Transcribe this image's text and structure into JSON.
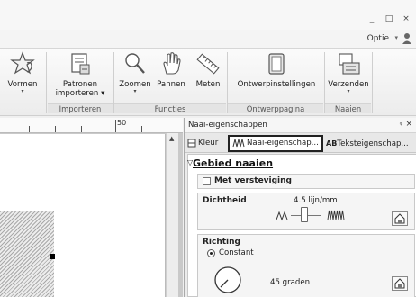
{
  "window": {
    "controls": [
      "_",
      "□",
      "×"
    ]
  },
  "topbar": {
    "options_label": "Optie",
    "options_arrow": "▾"
  },
  "ribbon": {
    "buttons": [
      {
        "id": "vormen",
        "label": "Vormen",
        "caret": "▾",
        "icon": "star-shapes-icon"
      },
      {
        "id": "patronen",
        "label": "Patronen importeren ▾",
        "icon": "import-pattern-icon"
      },
      {
        "id": "zoomen",
        "label": "Zoomen",
        "caret": "▾",
        "icon": "magnifier-icon"
      },
      {
        "id": "pannen",
        "label": "Pannen",
        "icon": "hand-icon"
      },
      {
        "id": "meten",
        "label": "Meten",
        "icon": "ruler-icon"
      },
      {
        "id": "ontwerpinstellingen",
        "label": "Ontwerpinstellingen",
        "icon": "design-settings-icon"
      },
      {
        "id": "verzenden",
        "label": "Verzenden",
        "caret": "▾",
        "icon": "send-machine-icon"
      }
    ],
    "groups": [
      "Importeren",
      "Functies",
      "Ontwerppagina",
      "Naaien"
    ]
  },
  "canvas": {
    "ruler_label": "50"
  },
  "panel": {
    "title": "Naai-eigenschappen",
    "pin": "ᵠ",
    "close": "×",
    "tabs": [
      {
        "label": "Kleur",
        "icon": "color-icon"
      },
      {
        "label": "Naai-eigenschap...",
        "icon": "stitch-icon",
        "active": true
      },
      {
        "label": "Teksteigenschap...",
        "icon": "text-props-icon"
      }
    ],
    "tab_text_prefix": "AB",
    "section_title": "Gebied naaien",
    "section_marker": "▽",
    "checkbox_label": "Met versteviging",
    "density_label": "Dichtheid",
    "density_value": "4.5 lijn/mm",
    "direction_label": "Richting",
    "radio_label": "Constant",
    "angle_value": "45 graden"
  },
  "colors": {
    "active_tab_border": "#222222",
    "canvas_bg": "#c9c9c9",
    "hatch": "#a9a9a9"
  }
}
